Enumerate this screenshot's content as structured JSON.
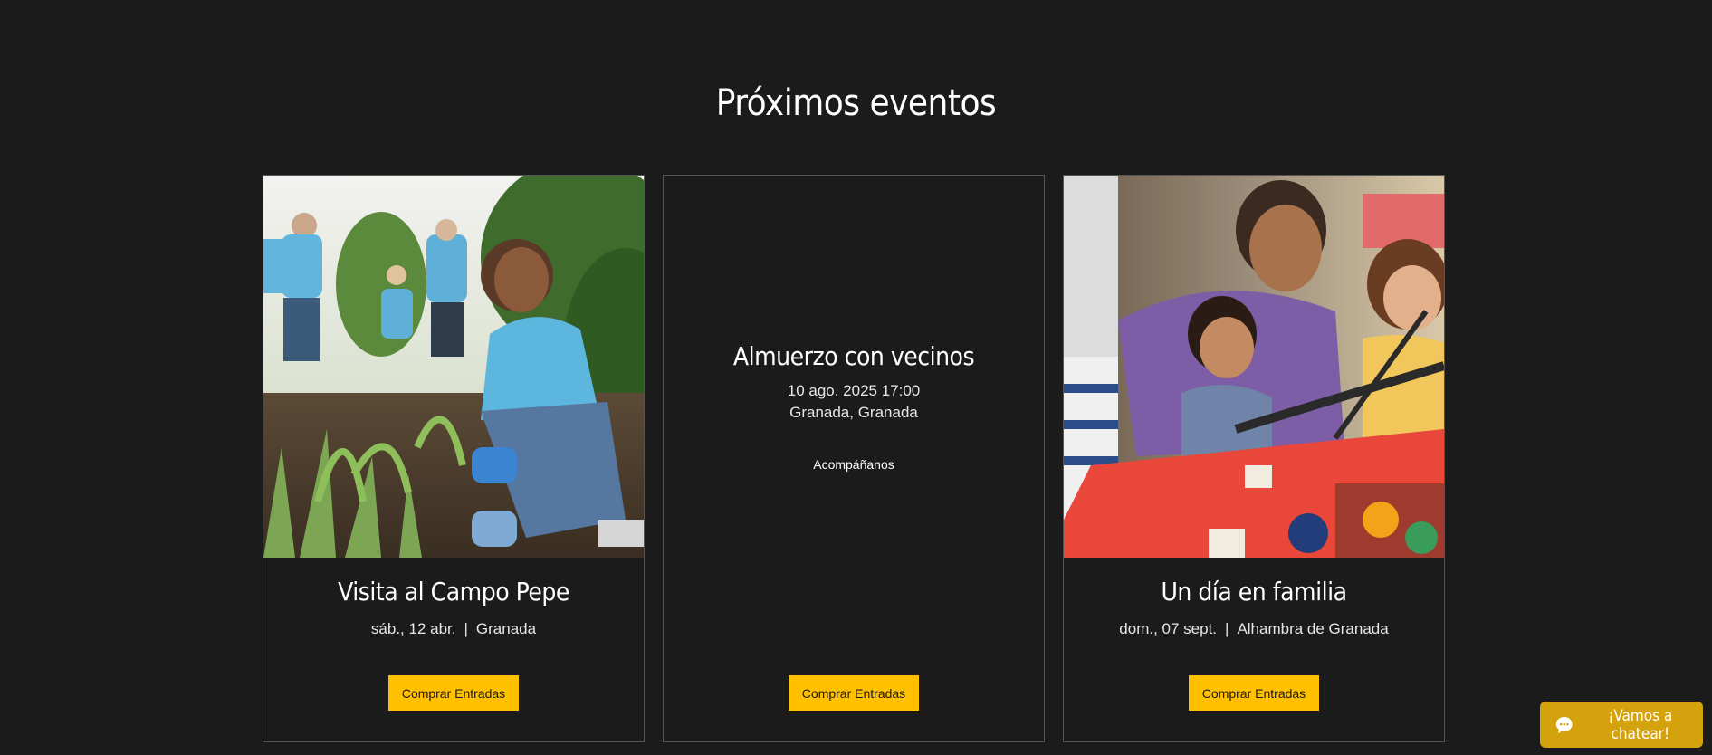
{
  "section": {
    "title": "Próximos eventos"
  },
  "events": [
    {
      "title": "Visita al Campo Pepe",
      "date": "sáb., 12 abr.",
      "location": "Granada",
      "button": "Comprar Entradas",
      "image": "volunteers-gardening-photo"
    },
    {
      "title": "Almuerzo con vecinos",
      "date": "10 ago. 2025 17:00",
      "location": "Granada, Granada",
      "link": "Acompáñanos",
      "button": "Comprar Entradas"
    },
    {
      "title": "Un día en familia",
      "date": "dom., 07 sept.",
      "location": "Alhambra de Granada",
      "button": "Comprar Entradas",
      "image": "family-fair-game-photo"
    }
  ],
  "chat": {
    "label": "¡Vamos a chatear!",
    "icon": "chat-bubble-icon"
  },
  "colors": {
    "background": "#1b1b1b",
    "accent": "#ffc000",
    "chat": "#d4a20c",
    "border": "#555555"
  }
}
